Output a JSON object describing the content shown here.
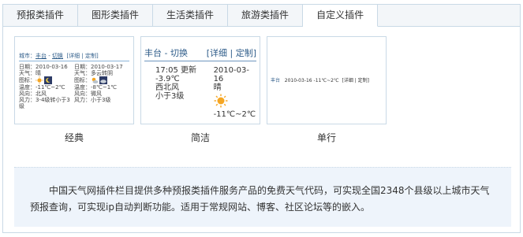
{
  "tabs": [
    {
      "label": "预报类插件"
    },
    {
      "label": "图形类插件"
    },
    {
      "label": "生活类插件"
    },
    {
      "label": "旅游类插件"
    },
    {
      "label": "自定义插件"
    }
  ],
  "active_tab": "自定义插件",
  "plugins": {
    "classic": {
      "caption": "经典",
      "city_label": "城市：",
      "city": "丰台",
      "sep": " - ",
      "switch": "切换",
      "links": "[详细 | 定制]",
      "day1": {
        "date": "日期：2010-03-16",
        "weather": "天气：晴",
        "icon_label": "图标：",
        "temp": "温度：-11℃~2℃",
        "wind_dir": "风向：北风",
        "wind": "风力：3-4级转小于3级"
      },
      "day2": {
        "date": "日期：2010-03-17",
        "weather": "天气：多云转阴",
        "icon_label": "图标：",
        "temp": "温度：-8℃~1℃",
        "wind_dir": "风向：微风",
        "wind": "风力：小于3级"
      }
    },
    "simple": {
      "caption": "简洁",
      "city": "丰台",
      "sep": " - ",
      "switch": "切换",
      "links": "[详细 | 定制]",
      "time": "17:05 更新",
      "current_temp": "-3.9℃",
      "wind_dir": "西北风",
      "wind": "小于3级",
      "date": "2010-03-16",
      "weather": "晴",
      "temp": "-11℃~2℃"
    },
    "single": {
      "caption": "单行",
      "city": "丰台",
      "date": "2010-03-16",
      "temp": "-11℃~2℃",
      "links": "[详细 | 定制]"
    }
  },
  "description": "中国天气网插件栏目提供多种预报类插件服务产品的免费天气代码，可实现全国2348个县级以上城市天气预报查询，可实现ip自动判断功能。适用于常规网站、博客、社区论坛等的嵌入。",
  "colors": {
    "tab_bar": "#f3f6f9",
    "border": "#c9d9e6",
    "desc_bg": "#eef4fb",
    "link": "#2f5d8a",
    "sun": "#f5a623"
  }
}
